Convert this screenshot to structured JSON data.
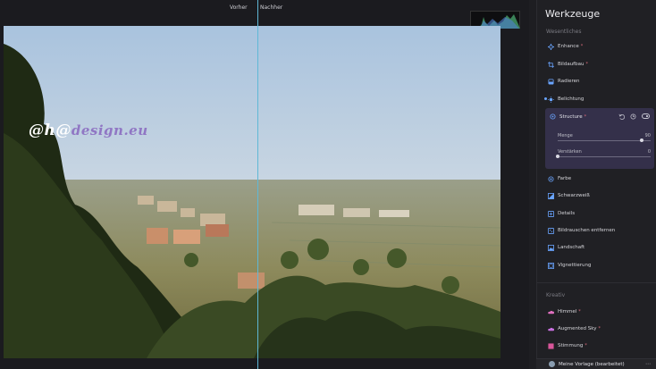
{
  "compare": {
    "before_label": "Vorher",
    "after_label": "Nachher"
  },
  "watermark": {
    "part_a": "@h@",
    "part_b": "design.eu"
  },
  "panel": {
    "title": "Werkzeuge",
    "section_essentials": "Wesentliches",
    "section_creative": "Kreativ",
    "tools": [
      {
        "label": "Enhance",
        "icon": "sparkle-icon",
        "ai": true
      },
      {
        "label": "Bildaufbau",
        "icon": "crop-icon",
        "ai": true
      },
      {
        "label": "Radieren",
        "icon": "eraser-icon",
        "ai": false
      },
      {
        "label": "Belichtung",
        "icon": "sun-icon",
        "ai": false
      }
    ],
    "structure": {
      "label": "Structure",
      "ai": true,
      "sliders": [
        {
          "name": "Menge",
          "value": "90",
          "fraction": 0.9
        },
        {
          "name": "Verstärken",
          "value": "0",
          "fraction": 0.0
        }
      ]
    },
    "tools2": [
      {
        "label": "Farbe",
        "icon": "palette-icon"
      },
      {
        "label": "Schwarzweiß",
        "icon": "bw-icon"
      },
      {
        "label": "Details",
        "icon": "details-icon"
      },
      {
        "label": "Bildrauschen entfernen",
        "icon": "denoise-icon"
      },
      {
        "label": "Landschaft",
        "icon": "landscape-icon"
      },
      {
        "label": "Vignettierung",
        "icon": "vignette-icon"
      }
    ],
    "creative": [
      {
        "label": "Himmel",
        "icon": "cloud-icon",
        "ai": true
      },
      {
        "label": "Augmented Sky",
        "icon": "sky-icon",
        "ai": true
      },
      {
        "label": "Stimmung",
        "icon": "mood-icon",
        "ai": true
      }
    ],
    "preset": "Meine Vorlage (bearbeitet)",
    "more": "⋯",
    "ai_mark": "*"
  },
  "colors": {
    "accent": "#5fb8d6",
    "ai_star": "#d86b7b",
    "card": "#34304a"
  }
}
